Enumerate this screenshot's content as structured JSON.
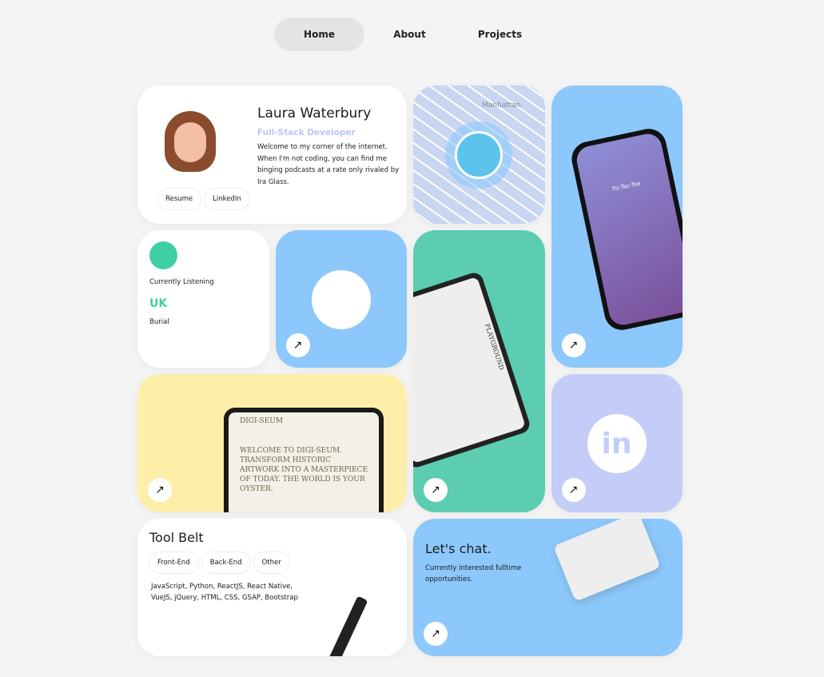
{
  "nav": {
    "tabs": [
      {
        "label": "Home",
        "active": true
      },
      {
        "label": "About"
      },
      {
        "label": "Projects"
      }
    ]
  },
  "profile": {
    "name": "Laura Waterbury",
    "role": "Full-Stack Developer",
    "bio": "Welcome to my corner of the internet. When I'm not coding, you can find me binging podcasts at a rate only rivaled by Ira Glass.",
    "buttons": [
      "Resume",
      "LinkedIn"
    ]
  },
  "map": {
    "label": "Manhattan"
  },
  "phone": {
    "screen_title": "Tic-Tac-Toe"
  },
  "spotify": {
    "status": "Currently Listening",
    "track": "UK",
    "artist": "Burial"
  },
  "playground": {
    "label": "PLAYGROUND"
  },
  "digi": {
    "logo": "DIGI-SEUM",
    "headline": "WELCOME TO DIGI-SEUM. TRANSFORM HISTORIC ARTWORK INTO A MASTERPIECE OF TODAY. THE WORLD IS YOUR OYSTER."
  },
  "tool": {
    "title": "Tool Belt",
    "tabs": [
      "Front-End",
      "Back-End",
      "Other"
    ],
    "skills": "JavaScript, Python, ReactJS, React Native, VueJS, jQuery, HTML, CSS, GSAP, Bootstrap"
  },
  "chat": {
    "title": "Let's chat.",
    "text": "Currently interested fulltime opportunities."
  },
  "arrow_icon": "↗",
  "colors": {
    "blue": "#8cc8fb",
    "green": "#5ccdb0",
    "yellow": "#fdeeaa",
    "lavender": "#c3cdf7",
    "role": "#b9c6f6",
    "spotify": "#3ecfa3"
  }
}
